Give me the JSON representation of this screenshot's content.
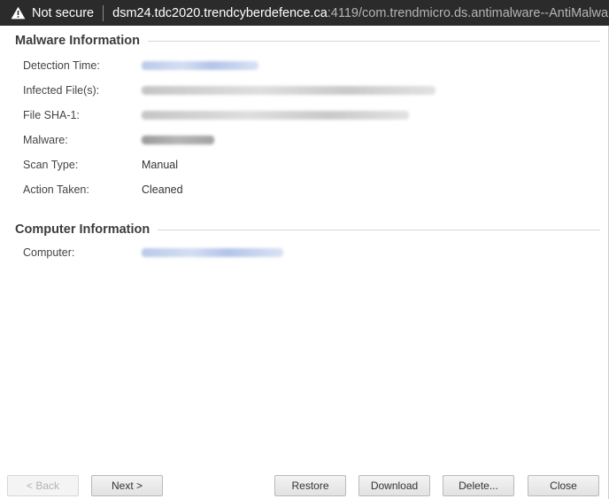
{
  "browser": {
    "security_label": "Not secure",
    "url_host": "dsm24.tdc2020.trendcyberdefence.ca",
    "url_path": ":4119/com.trendmicro.ds.antimalware--AntiMalwa..."
  },
  "malware_info": {
    "title": "Malware Information",
    "rows": [
      {
        "label": "Detection Time:",
        "value": ""
      },
      {
        "label": "Infected File(s):",
        "value": ""
      },
      {
        "label": "File SHA-1:",
        "value": ""
      },
      {
        "label": "Malware:",
        "value": ""
      },
      {
        "label": "Scan Type:",
        "value": "Manual"
      },
      {
        "label": "Action Taken:",
        "value": "Cleaned"
      }
    ]
  },
  "computer_info": {
    "title": "Computer Information",
    "rows": [
      {
        "label": "Computer:",
        "value": ""
      }
    ]
  },
  "buttons": {
    "back": "< Back",
    "next": "Next >",
    "restore": "Restore",
    "download": "Download",
    "delete": "Delete...",
    "close": "Close"
  }
}
